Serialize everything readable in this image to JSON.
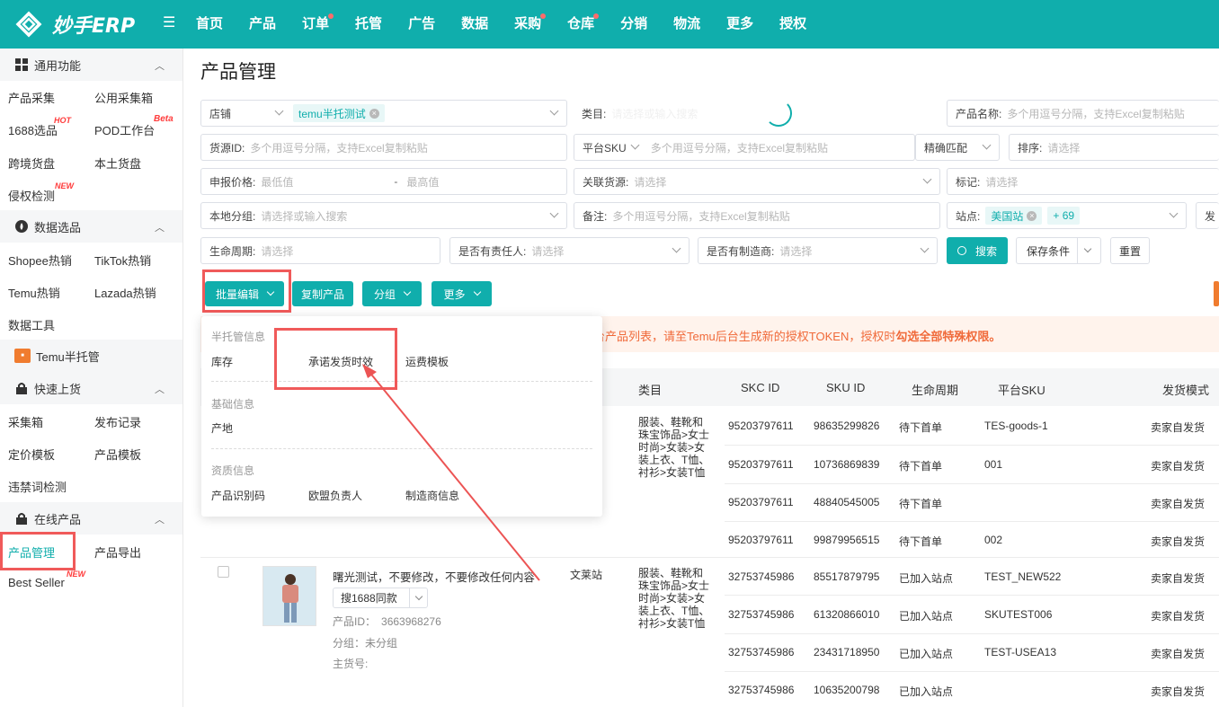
{
  "app": {
    "name": "妙手ERP"
  },
  "nav": [
    "首页",
    "产品",
    "订单",
    "托管",
    "广告",
    "数据",
    "采购",
    "仓库",
    "分销",
    "物流",
    "更多",
    "授权"
  ],
  "sidebar": {
    "sec1": "通用功能",
    "items1": [
      "产品采集",
      "公用采集箱",
      "1688选品",
      "POD工作台",
      "跨境货盘",
      "本土货盘",
      "侵权检测"
    ],
    "badges": {
      "hot": "HOT",
      "beta": "Beta",
      "new": "NEW"
    },
    "sec2": "数据选品",
    "items2": [
      "Shopee热销",
      "TikTok热销",
      "Temu热销",
      "Lazada热销",
      "数据工具"
    ],
    "sec3": "Temu半托管",
    "sec4": "快速上货",
    "items4": [
      "采集箱",
      "发布记录",
      "定价模板",
      "产品模板",
      "违禁词检测"
    ],
    "sec5": "在线产品",
    "items5": [
      "产品管理",
      "产品导出",
      "Best Seller"
    ]
  },
  "page": {
    "title": "产品管理"
  },
  "filters": {
    "store_label": "店铺",
    "store_tag": "temu半托测试",
    "category_label": "类目:",
    "category_ph": "请选择或输入搜索",
    "pname_label": "产品名称:",
    "pname_ph": "多个用逗号分隔，支持Excel复制粘贴",
    "source_label": "货源ID:",
    "source_ph": "多个用逗号分隔，支持Excel复制粘贴",
    "psku_label": "平台SKU",
    "psku_ph": "多个用逗号分隔，支持Excel复制粘贴",
    "match_label": "精确匹配",
    "sort_label": "排序:",
    "sort_ph": "请选择",
    "price_label": "申报价格:",
    "price_min": "最低值",
    "price_dash": "-",
    "price_max": "最高值",
    "related_label": "关联货源:",
    "related_ph": "请选择",
    "mark_label": "标记:",
    "mark_ph": "请选择",
    "group_label": "本地分组:",
    "group_ph": "请选择或输入搜索",
    "note_label": "备注:",
    "note_ph": "多个用逗号分隔，支持Excel复制粘贴",
    "site_label": "站点:",
    "site_tag": "美国站",
    "site_more": "+ 69",
    "ship_label": "发",
    "life_label": "生命周期:",
    "life_ph": "请选择",
    "owner_label": "是否有责任人:",
    "owner_ph": "请选择",
    "maker_label": "是否有制造商:",
    "maker_ph": "请选择",
    "search_btn": "搜索",
    "save_btn": "保存条件",
    "reset_btn": "重置"
  },
  "toolbar": {
    "bulk_edit": "批量编辑",
    "copy": "复制产品",
    "group": "分组",
    "more": "更多"
  },
  "alert": {
    "text": "台产品列表，请至Temu后台生成新的授权TOKEN，授权时",
    "bold": "勾选全部特殊权限。"
  },
  "dropdown": {
    "h1": "半托管信息",
    "i1": [
      "库存",
      "承诺发货时效",
      "运费模板"
    ],
    "h2": "基础信息",
    "i2": [
      "产地"
    ],
    "h3": "资质信息",
    "i3": [
      "产品识别码",
      "欧盟负责人",
      "制造商信息"
    ]
  },
  "table": {
    "headers": [
      "类目",
      "SKC ID",
      "SKU ID",
      "生命周期",
      "平台SKU",
      "发货模式"
    ],
    "category": "服装、鞋靴和珠宝饰品>女士时尚>女装>女装上衣、T恤、衬衫>女装T恤",
    "rows": [
      {
        "skc": "95203797611",
        "sku": "98635299826",
        "life": "待下首单",
        "psku": "TES-goods-1",
        "ship": "卖家自发货"
      },
      {
        "skc": "95203797611",
        "sku": "10736869839",
        "life": "待下首单",
        "psku": "001",
        "ship": "卖家自发货"
      },
      {
        "skc": "95203797611",
        "sku": "48840545005",
        "life": "待下首单",
        "psku": "",
        "ship": "卖家自发货"
      },
      {
        "skc": "95203797611",
        "sku": "99879956515",
        "life": "待下首单",
        "psku": "002",
        "ship": "卖家自发货"
      },
      {
        "skc": "32753745986",
        "sku": "85517879795",
        "life": "已加入站点",
        "psku": "TEST_NEW522",
        "ship": "卖家自发货"
      },
      {
        "skc": "32753745986",
        "sku": "61320866010",
        "life": "已加入站点",
        "psku": "SKUTEST006",
        "ship": "卖家自发货"
      },
      {
        "skc": "32753745986",
        "sku": "23431718950",
        "life": "已加入站点",
        "psku": "TEST-USEA13",
        "ship": "卖家自发货"
      },
      {
        "skc": "32753745986",
        "sku": "10635200798",
        "life": "已加入站点",
        "psku": "",
        "ship": "卖家自发货"
      }
    ],
    "product2": {
      "title": "曙光测试，不要修改，不要修改任何内容",
      "search_btn": "搜1688同款",
      "pid_label": "产品ID：",
      "pid": "3663968276",
      "group": "分组：未分组",
      "main_no": "主货号:",
      "site": "文莱站"
    }
  }
}
